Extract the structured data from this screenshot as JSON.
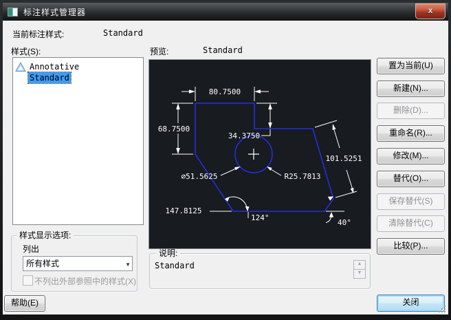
{
  "window": {
    "title": "标注样式管理器",
    "close_label": "x"
  },
  "header": {
    "current_style_label": "当前标注样式:",
    "current_style_value": "Standard"
  },
  "styles_panel": {
    "label": "样式(S):",
    "items": [
      {
        "name": "Annotative"
      },
      {
        "name": "Standard",
        "selected": true
      }
    ]
  },
  "preview": {
    "label": "预览:",
    "style_name": "Standard",
    "dims": {
      "top": "80.7500",
      "left": "68.7500",
      "step": "34.3750",
      "slant": "101.5251",
      "diameter": "∅51.5625",
      "radius": "R25.7813",
      "bottom": "147.8125",
      "angle_left": "124°",
      "angle_right": "40°"
    },
    "colors": {
      "background": "#181b1f",
      "geometry": "#2230dd",
      "dimension": "#ffffff"
    }
  },
  "side_buttons": [
    {
      "label": "置为当前(U)",
      "enabled": true
    },
    {
      "label": "新建(N)...",
      "enabled": true
    },
    {
      "label": "删除(D)...",
      "enabled": false
    },
    {
      "label": "重命名(R)...",
      "enabled": true
    },
    {
      "label": "修改(M)...",
      "enabled": true
    },
    {
      "label": "替代(O)...",
      "enabled": true
    },
    {
      "label": "保存替代(S)",
      "enabled": false
    },
    {
      "label": "清除替代(C)",
      "enabled": false
    },
    {
      "label": "比较(P)...",
      "enabled": true
    }
  ],
  "display_options": {
    "group_label": "样式显示选项:",
    "list_label": "列出",
    "combo_value": "所有样式",
    "checkbox_label": "不列出外部参照中的样式(X)",
    "checkbox_checked": false
  },
  "description": {
    "group_label": "说明:",
    "value": "Standard"
  },
  "footer": {
    "help": "帮助(E)",
    "close": "关闭"
  },
  "icons": {
    "dropdown_arrow": "▼",
    "spin_up": "▲",
    "spin_down": "▼"
  }
}
